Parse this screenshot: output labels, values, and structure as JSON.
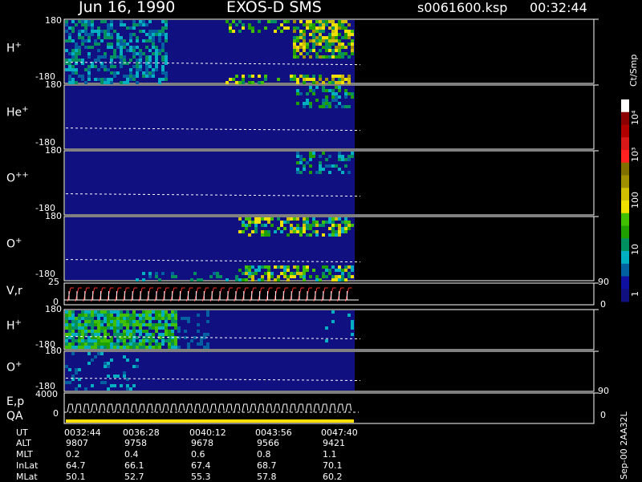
{
  "header": {
    "date": "Jun 16, 1990",
    "instrument": "EXOS-D SMS",
    "file": "s0061600.ksp",
    "time": "00:32:44"
  },
  "panels": [
    {
      "label": "H",
      "sup": "+",
      "ymax": "180",
      "ymin": "-180"
    },
    {
      "label": "He",
      "sup": "+",
      "ymax": "180",
      "ymin": "-180"
    },
    {
      "label": "O",
      "sup": "++",
      "ymax": "180",
      "ymin": "-180"
    },
    {
      "label": "O",
      "sup": "+",
      "ymax": "180",
      "ymin": "-180"
    },
    {
      "label": "V,r",
      "sup": "",
      "ymax": "25",
      "ymin": "0",
      "rmax": "90",
      "rmin": "0"
    },
    {
      "label": "H",
      "sup": "+",
      "ymax": "180",
      "ymin": "-180"
    },
    {
      "label": "O",
      "sup": "+",
      "ymax": "180",
      "ymin": "-180"
    },
    {
      "label": "E,p",
      "sub": "QA",
      "ymax": "4000",
      "ymin": "0",
      "rmax": "90",
      "rmin": "0"
    }
  ],
  "colorbar": {
    "unit": "Ct/Smp",
    "labels": [
      "10⁴",
      "10³",
      "100",
      "10",
      "1"
    ],
    "colors": [
      "#ffffff",
      "#8b0000",
      "#b00000",
      "#d81818",
      "#ff2020",
      "#807000",
      "#a09000",
      "#d0c000",
      "#f0e000",
      "#40c000",
      "#20a000",
      "#009060",
      "#00b0c0",
      "#0060a0",
      "#1010a0",
      "#101080"
    ]
  },
  "footer": {
    "row_labels": [
      "UT",
      "ALT",
      "MLT",
      "InLat",
      "MLat"
    ],
    "columns": [
      [
        "0032:44",
        "9807",
        "0.2",
        "64.7",
        "50.1"
      ],
      [
        "0036:28",
        "9758",
        "0.4",
        "66.1",
        "52.7"
      ],
      [
        "0040:12",
        "9678",
        "0.6",
        "67.4",
        "55.3"
      ],
      [
        "0043:56",
        "9566",
        "0.8",
        "68.7",
        "57.8"
      ],
      [
        "0047:40",
        "9421",
        "1.1",
        "70.1",
        "60.2"
      ]
    ],
    "stamp": "Sep-00 2AA32L"
  },
  "chart_data": {
    "type": "heatmap",
    "title": "Jun 16, 1990  EXOS-D SMS",
    "x": [
      "0032:44",
      "0036:28",
      "0040:12",
      "0043:56",
      "0047:40"
    ],
    "xlabel": "UT",
    "colorscale_label": "Ct/Smp",
    "colorscale_range": [
      1,
      10000
    ],
    "panels": [
      "H+",
      "He+",
      "O++",
      "O+",
      "V,r",
      "H+",
      "O+",
      "E,p QA"
    ],
    "pitch_angle_range": [
      -180,
      180
    ]
  }
}
